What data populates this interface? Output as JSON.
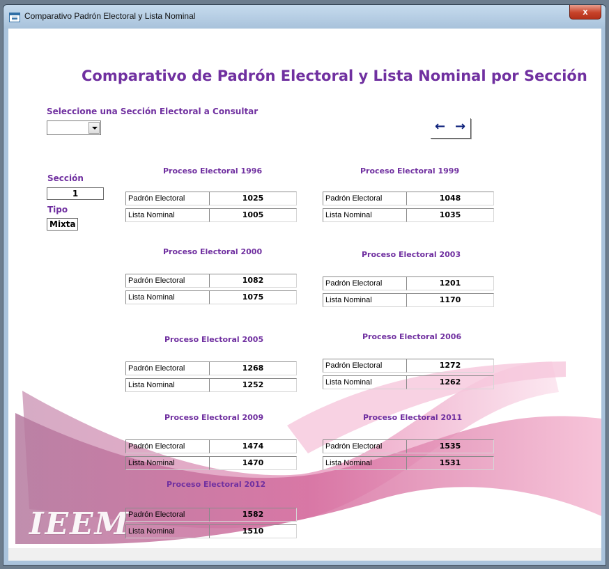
{
  "window": {
    "title": "Comparativo Padrón Electoral y Lista Nominal",
    "close_label": "x"
  },
  "form": {
    "title": "Comparativo de Padrón Electoral y Lista Nominal por Sección",
    "select_label": "Seleccione una Sección Electoral a Consultar",
    "section_combo_value": "",
    "prev_icon": "←",
    "next_icon": "→",
    "seccion_label": "Sección",
    "seccion_value": "1",
    "tipo_label": "Tipo",
    "tipo_value": "Mixta",
    "row_labels": {
      "padron": "Padrón Electoral",
      "lista": "Lista Nominal"
    },
    "logo_text": "IEEM"
  },
  "processes": [
    {
      "title": "Proceso Electoral 1996",
      "padron": "1025",
      "lista": "1005"
    },
    {
      "title": "Proceso Electoral 1999",
      "padron": "1048",
      "lista": "1035"
    },
    {
      "title": "Proceso Electoral 2000",
      "padron": "1082",
      "lista": "1075"
    },
    {
      "title": "Proceso Electoral 2003",
      "padron": "1201",
      "lista": "1170"
    },
    {
      "title": "Proceso Electoral 2005",
      "padron": "1268",
      "lista": "1252"
    },
    {
      "title": "Proceso Electoral 2006",
      "padron": "1272",
      "lista": "1262"
    },
    {
      "title": "Proceso Electoral 2009",
      "padron": "1474",
      "lista": "1470"
    },
    {
      "title": "Proceso Electoral 2011",
      "padron": "1535",
      "lista": "1531"
    },
    {
      "title": "Proceso Electoral 2012",
      "padron": "1582",
      "lista": "1510"
    }
  ],
  "colors": {
    "accent": "#7030a0",
    "swoosh": "#c95f93"
  }
}
